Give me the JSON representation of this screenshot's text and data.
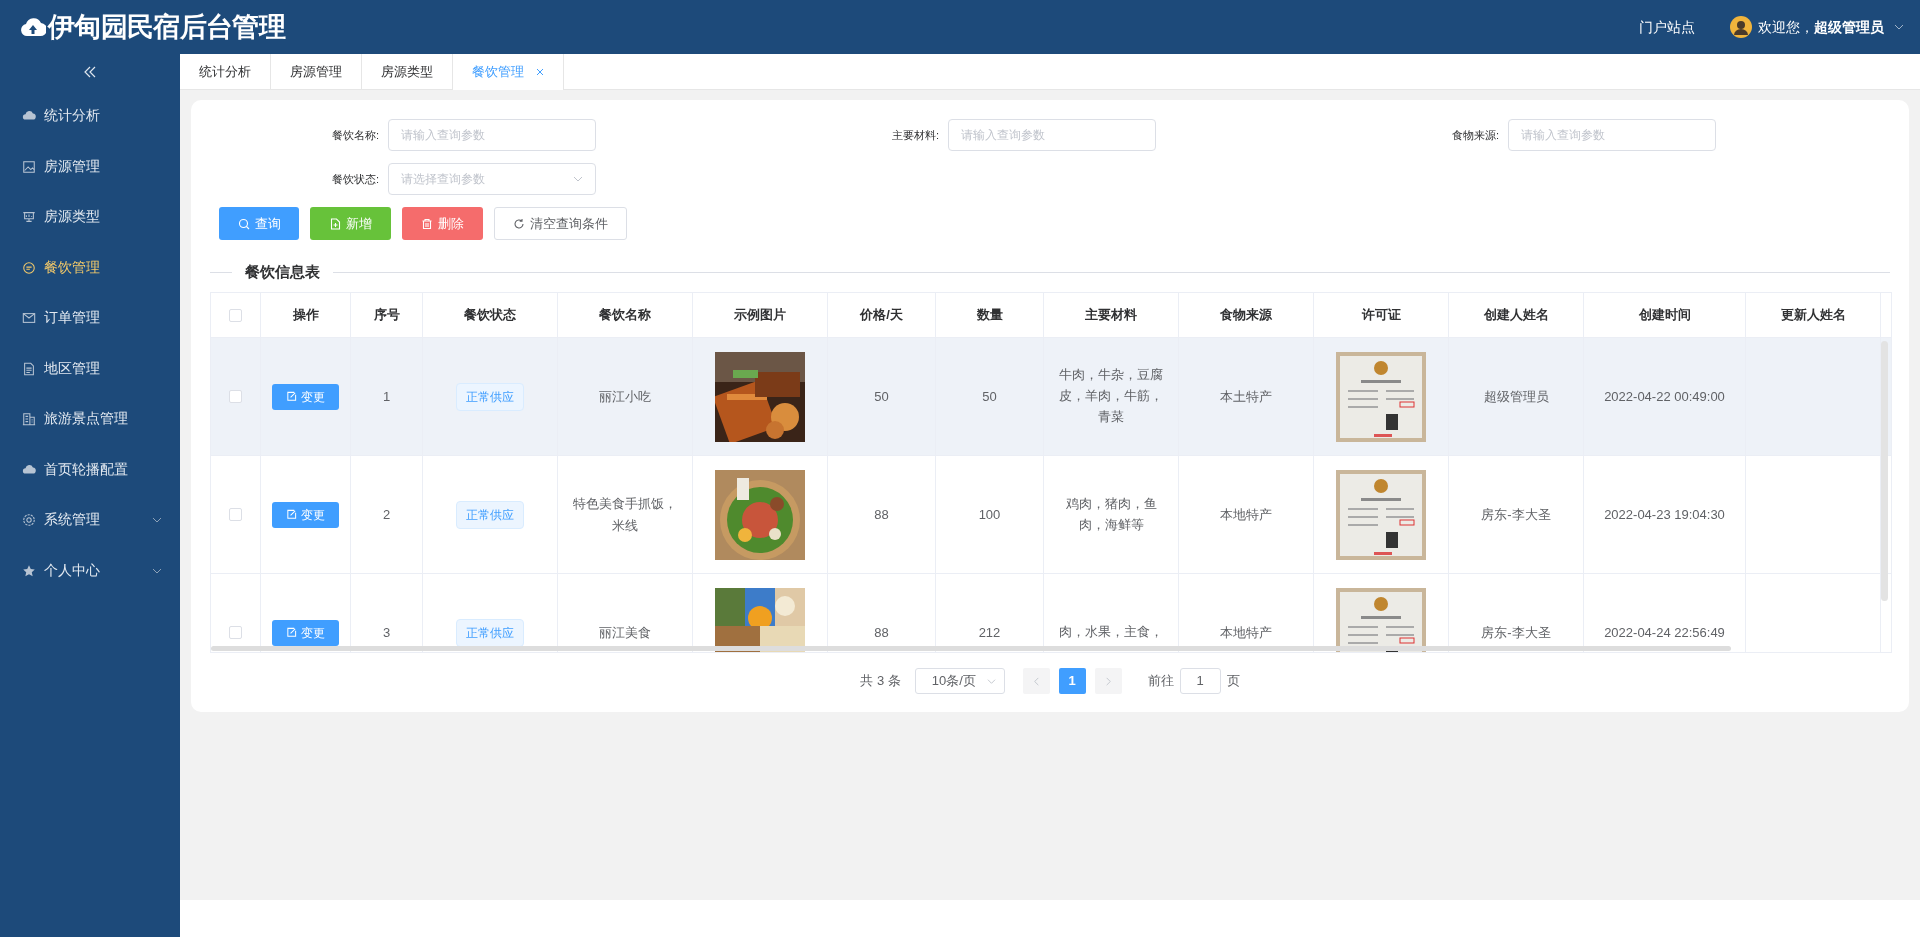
{
  "header": {
    "title": "伊甸园民宿后台管理",
    "portal_link": "门户站点",
    "welcome": "欢迎您，**超级管理员**"
  },
  "sidebar": {
    "items": [
      {
        "label": "统计分析",
        "selected": false,
        "expandable": false
      },
      {
        "label": "房源管理",
        "selected": false,
        "expandable": false
      },
      {
        "label": "房源类型",
        "selected": false,
        "expandable": false
      },
      {
        "label": "餐饮管理",
        "selected": true,
        "expandable": false
      },
      {
        "label": "订单管理",
        "selected": false,
        "expandable": false
      },
      {
        "label": "地区管理",
        "selected": false,
        "expandable": false
      },
      {
        "label": "旅游景点管理",
        "selected": false,
        "expandable": false
      },
      {
        "label": "首页轮播配置",
        "selected": false,
        "expandable": false
      },
      {
        "label": "系统管理",
        "selected": false,
        "expandable": true
      },
      {
        "label": "个人中心",
        "selected": false,
        "expandable": true
      }
    ]
  },
  "tabs": [
    {
      "label": "统计分析",
      "selected": false,
      "closable": false
    },
    {
      "label": "房源管理",
      "selected": false,
      "closable": false
    },
    {
      "label": "房源类型",
      "selected": false,
      "closable": false
    },
    {
      "label": "餐饮管理",
      "selected": true,
      "closable": true
    }
  ],
  "filters": [
    {
      "kind": "input",
      "label": "餐饮名称:",
      "placeholder": "请输入查询参数"
    },
    {
      "kind": "input",
      "label": "主要材料:",
      "placeholder": "请输入查询参数"
    },
    {
      "kind": "input",
      "label": "食物来源:",
      "placeholder": "请输入查询参数"
    },
    {
      "kind": "select",
      "label": "餐饮状态:",
      "placeholder": "请选择查询参数"
    }
  ],
  "buttons": [
    {
      "kind": "search",
      "label": "查询"
    },
    {
      "kind": "add",
      "label": "新增"
    },
    {
      "kind": "delete",
      "label": "删除"
    },
    {
      "kind": "reset",
      "label": "清空查询条件"
    }
  ],
  "section_title": "餐饮信息表",
  "table": {
    "select_all_checked": false,
    "columns": [
      "操作",
      "序号",
      "餐饮状态",
      "餐饮名称",
      "示例图片",
      "价格/天",
      "数量",
      "主要材料",
      "食物来源",
      "许可证",
      "创建人姓名",
      "创建时间",
      "更新人姓名"
    ],
    "rows": [
      {
        "checked": false,
        "highlighted": true,
        "action": "变更",
        "index": "1",
        "status": "正常供应",
        "name": "丽江小吃",
        "price": "50",
        "quantity": "50",
        "materials": "牛肉，牛杂，豆腐皮，羊肉，牛筋，青菜",
        "source": "本土特产",
        "creator": "超级管理员",
        "created": "2022-04-22 00:49:00"
      },
      {
        "checked": false,
        "highlighted": false,
        "action": "变更",
        "index": "2",
        "status": "正常供应",
        "name": "特色美食手抓饭，米线",
        "price": "88",
        "quantity": "100",
        "materials": "鸡肉，猪肉，鱼肉，海鲜等",
        "source": "本地特产",
        "creator": "房东-李大圣",
        "created": "2022-04-23 19:04:30"
      },
      {
        "checked": false,
        "highlighted": false,
        "action": "变更",
        "index": "3",
        "status": "正常供应",
        "name": "丽江美食",
        "price": "88",
        "quantity": "212",
        "materials": "肉，水果，主食，",
        "source": "本地特产",
        "creator": "房东-李大圣",
        "created": "2022-04-24 22:56:49"
      }
    ]
  },
  "pagination": {
    "total": "共 3 条",
    "page_size": "10条/页",
    "pages": [
      {
        "label": "1",
        "selected": true
      }
    ],
    "goto_label": "前往",
    "goto_value": "1",
    "goto_suffix": "页"
  }
}
